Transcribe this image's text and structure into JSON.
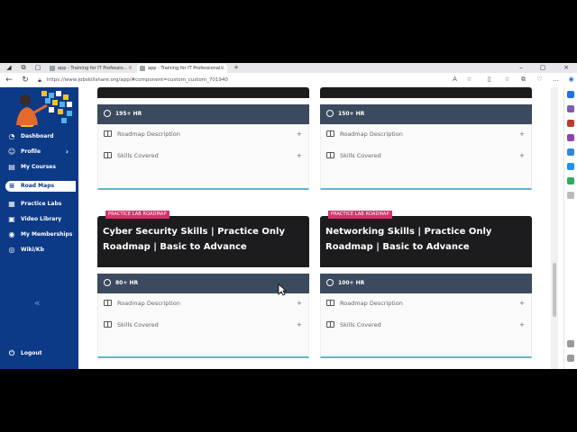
{
  "browser": {
    "tabs": [
      {
        "label": "app - Training for IT Professio..."
      },
      {
        "label": "app - Training for IT Professional..."
      }
    ],
    "new_tab": "+",
    "url": "https://www.jobskillshare.org/app/#component=custom_custom_701940"
  },
  "sidebar": {
    "items": [
      {
        "label": "Dashboard",
        "icon": "dashboard-icon",
        "glyph": "◔"
      },
      {
        "label": "Profile",
        "icon": "user-icon",
        "glyph": "☺",
        "chevron": "›"
      },
      {
        "label": "My Courses",
        "icon": "courses-icon",
        "glyph": "▤"
      },
      {
        "label": "Road Maps",
        "icon": "roadmap-icon",
        "glyph": "≡"
      },
      {
        "label": "Practice Labs",
        "icon": "labs-icon",
        "glyph": "▦"
      },
      {
        "label": "Video Library",
        "icon": "video-icon",
        "glyph": "▣"
      },
      {
        "label": "My Memberships",
        "icon": "membership-icon",
        "glyph": "◉"
      },
      {
        "label": "Wiki/Kb",
        "icon": "wiki-icon",
        "glyph": "◎"
      }
    ],
    "collapse_glyph": "«",
    "logout": {
      "label": "Logout",
      "glyph": "⏻"
    }
  },
  "cards": [
    {
      "hours": "195+ HR",
      "rows": [
        "Roadmap Description",
        "Skills Covered"
      ]
    },
    {
      "hours": "150+ HR",
      "rows": [
        "Roadmap Description",
        "Skills Covered"
      ]
    },
    {
      "badge": "PRACTICE LAB ROADMAP",
      "title": "Cyber Security Skills | Practice Only Roadmap | Basic to Advance",
      "hours": "80+ HR",
      "rows": [
        "Roadmap Description",
        "Skills Covered"
      ]
    },
    {
      "badge": "PRACTICE LAB ROADMAP",
      "title": "Networking Skills | Practice Only Roadmap | Basic to Advance",
      "hours": "100+ HR",
      "rows": [
        "Roadmap Description",
        "Skills Covered"
      ]
    }
  ],
  "plus_glyph": "+",
  "colors": {
    "sidebar": "#0d3a86",
    "badge": "#d6336c",
    "hr_bar": "#3b4a5e",
    "card_header": "#1c1c1e"
  }
}
